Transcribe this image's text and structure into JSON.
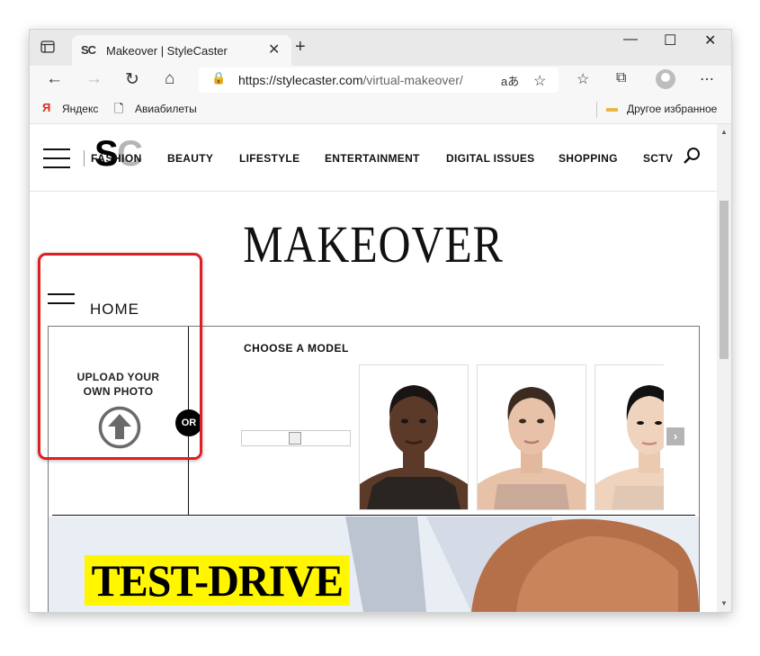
{
  "browser": {
    "tab_favicon": "SC",
    "tab_title": "Makeover | StyleCaster",
    "url_host": "https://stylecaster.com",
    "url_path": "/virtual-makeover/",
    "bookmarks": [
      {
        "label": "Яндекс",
        "icon": "yandex-icon"
      },
      {
        "label": "Авиабилеты",
        "icon": "document-icon"
      }
    ],
    "other_bookmarks": "Другое избранное"
  },
  "site": {
    "logo": {
      "s": "S",
      "c": "C",
      "text": "FASHION"
    },
    "menu": [
      "BEAUTY",
      "LIFESTYLE",
      "ENTERTAINMENT",
      "DIGITAL ISSUES",
      "SHOPPING",
      "SCTV"
    ],
    "page_title": "MAKEOVER",
    "home_label": "HOME"
  },
  "makeover": {
    "upload_label": "UPLOAD YOUR OWN PHOTO",
    "or_label": "OR",
    "choose_label": "CHOOSE A MODEL",
    "next_arrow": "›",
    "models": [
      {
        "name": "model-1",
        "skin": "#5b3a29",
        "hair": "#1a1512",
        "top": "#2b2522",
        "bg": "#ffffff"
      },
      {
        "name": "model-2",
        "skin": "#e8c2a8",
        "hair": "#3a2a20",
        "top": "#c9aa98",
        "bg": "#ffffff"
      },
      {
        "name": "model-3",
        "skin": "#f0d3bd",
        "hair": "#111111",
        "top": "#e0c8b5",
        "bg": "#ffffff"
      }
    ]
  },
  "hero": {
    "text": "TEST-DRIVE",
    "highlight_color": "#fff600"
  },
  "colors": {
    "highlight_border": "#e01e23",
    "accent_yellow": "#fff600"
  }
}
